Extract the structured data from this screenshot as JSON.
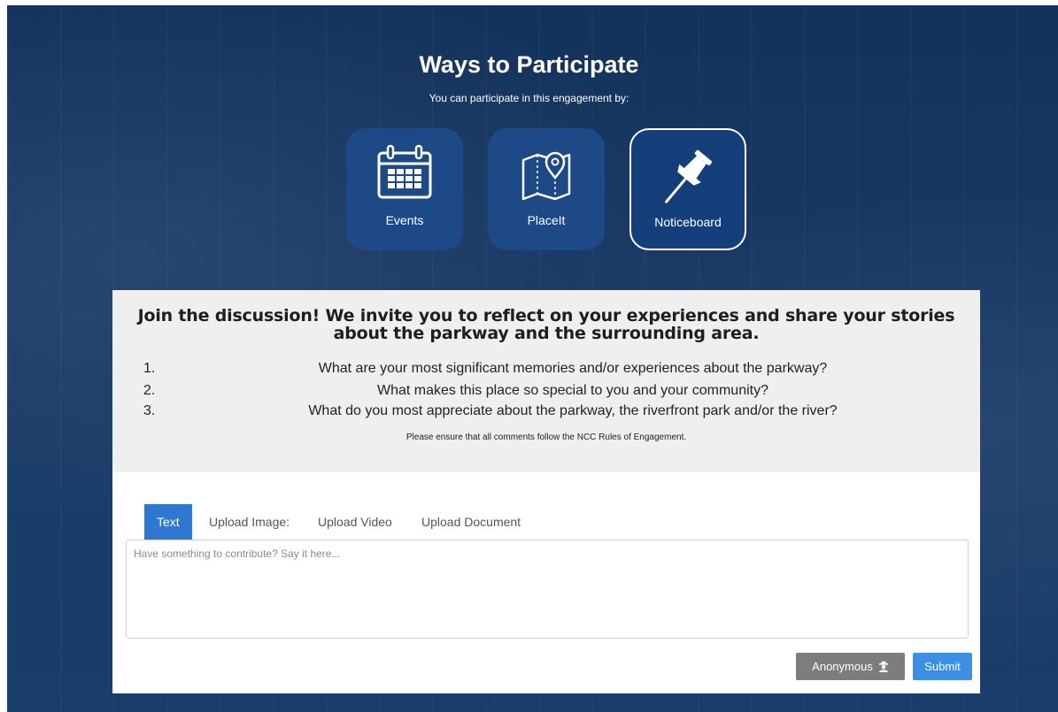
{
  "header": {
    "title": "Ways to Participate",
    "subtitle": "You can participate in this engagement by:"
  },
  "tiles": [
    {
      "label": "Events",
      "icon": "calendar-icon"
    },
    {
      "label": "PlaceIt",
      "icon": "map-pin-icon"
    },
    {
      "label": "Noticeboard",
      "icon": "pushpin-icon",
      "active": true
    }
  ],
  "intro": {
    "heading": "Join the discussion! We invite you to reflect on your experiences and share your stories about the parkway and the surrounding area.",
    "questions": [
      {
        "num": "1.",
        "text": "What are your most significant memories and/or experiences about the parkway?"
      },
      {
        "num": "2.",
        "text": "What makes this place so special to you and your community?"
      },
      {
        "num": "3.",
        "text": "What do you most appreciate about the parkway, the riverfront park and/or the river?"
      }
    ],
    "rules_note": "Please ensure that all comments follow the NCC Rules of Engagement."
  },
  "tabs": [
    {
      "label": "Text",
      "active": true
    },
    {
      "label": "Upload Image:"
    },
    {
      "label": "Upload Video"
    },
    {
      "label": "Upload Document"
    }
  ],
  "comment": {
    "placeholder": "Have something to contribute? Say it here...",
    "value": ""
  },
  "buttons": {
    "anonymous": "Anonymous",
    "submit": "Submit"
  },
  "colors": {
    "background": "#183a66",
    "tile": "#1d4a86",
    "active_tab": "#2e78d2",
    "submit": "#3c8fe3",
    "anonymous": "#7d7d7d"
  }
}
